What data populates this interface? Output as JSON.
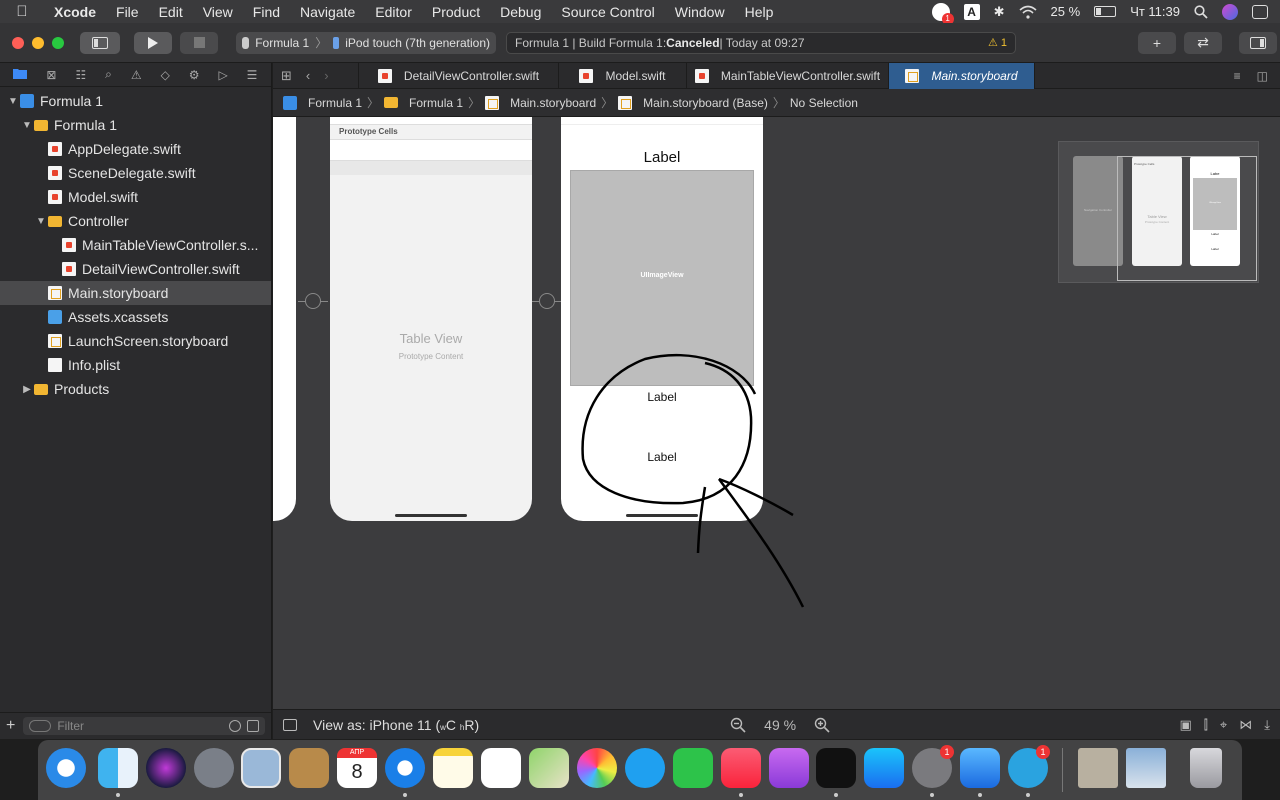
{
  "menubar": {
    "app": "Xcode",
    "items": [
      "File",
      "Edit",
      "View",
      "Find",
      "Navigate",
      "Editor",
      "Product",
      "Debug",
      "Source Control",
      "Window",
      "Help"
    ],
    "status": {
      "battery": "25 %",
      "battery_level": 0.25,
      "clock": "Чт 11:39",
      "input_source": "A",
      "notification_badge": "1"
    }
  },
  "toolbar": {
    "scheme": "Formula 1",
    "destination": "iPod touch (7th generation)",
    "activity": {
      "prefix": "Formula 1 | Build Formula 1: ",
      "status": "Canceled",
      "suffix": " | Today at 09:27",
      "warnings": "1"
    }
  },
  "navigator": {
    "tabs": [
      "project-icon",
      "source-control-icon",
      "symbol-icon",
      "find-icon",
      "issue-icon",
      "test-icon",
      "debug-icon",
      "breakpoint-icon",
      "report-icon"
    ],
    "tree": [
      {
        "label": "Formula 1",
        "type": "project",
        "depth": 0,
        "expanded": true
      },
      {
        "label": "Formula 1",
        "type": "folder",
        "depth": 1,
        "expanded": true
      },
      {
        "label": "AppDelegate.swift",
        "type": "swift",
        "depth": 2
      },
      {
        "label": "SceneDelegate.swift",
        "type": "swift",
        "depth": 2
      },
      {
        "label": "Model.swift",
        "type": "swift",
        "depth": 2
      },
      {
        "label": "Controller",
        "type": "folder",
        "depth": 2,
        "expanded": true
      },
      {
        "label": "MainTableViewController.s...",
        "type": "swift",
        "depth": 3
      },
      {
        "label": "DetailViewController.swift",
        "type": "swift",
        "depth": 3
      },
      {
        "label": "Main.storyboard",
        "type": "storyboard",
        "depth": 2,
        "selected": true
      },
      {
        "label": "Assets.xcassets",
        "type": "assets",
        "depth": 2
      },
      {
        "label": "LaunchScreen.storyboard",
        "type": "storyboard",
        "depth": 2
      },
      {
        "label": "Info.plist",
        "type": "plist",
        "depth": 2
      },
      {
        "label": "Products",
        "type": "folder",
        "depth": 1,
        "expanded": false
      }
    ],
    "filter_placeholder": "Filter"
  },
  "editor": {
    "tabs": [
      {
        "label": "DetailViewController.swift",
        "active": false
      },
      {
        "label": "Model.swift",
        "active": false
      },
      {
        "label": "MainTableViewController.swift",
        "active": false
      },
      {
        "label": "Main.storyboard",
        "active": true
      }
    ],
    "jumpbar": [
      "Formula 1",
      "Formula 1",
      "Main.storyboard",
      "Main.storyboard (Base)",
      "No Selection"
    ]
  },
  "canvas": {
    "table_scene": {
      "header": "Prototype Cells",
      "title": "Table View",
      "subtitle": "Prototype Content"
    },
    "detail_scene": {
      "top_label": "Label",
      "image_label": "UIImageView",
      "label_2": "Label",
      "label_3": "Label"
    },
    "minimap": {
      "scene_1": "Navigation Controller",
      "scene_2_header": "Prototype Cells",
      "scene_2_title": "Table View",
      "scene_2_sub": "Prototype Content",
      "scene_3_label": "Labe",
      "scene_3_image": "UIImageView",
      "scene_3_l2": "Label",
      "scene_3_l3": "Label"
    }
  },
  "bottombar": {
    "view_as": "View as: iPhone 11 (",
    "size_w": "w",
    "size_c": "C",
    "size_h": "h",
    "size_r": "R",
    "view_as_end": ")",
    "zoom": "49 %"
  },
  "dock": {
    "calendar_month": "АПР",
    "calendar_day": "8",
    "badges": {
      "system_preferences": "1",
      "telegram": "1"
    }
  }
}
